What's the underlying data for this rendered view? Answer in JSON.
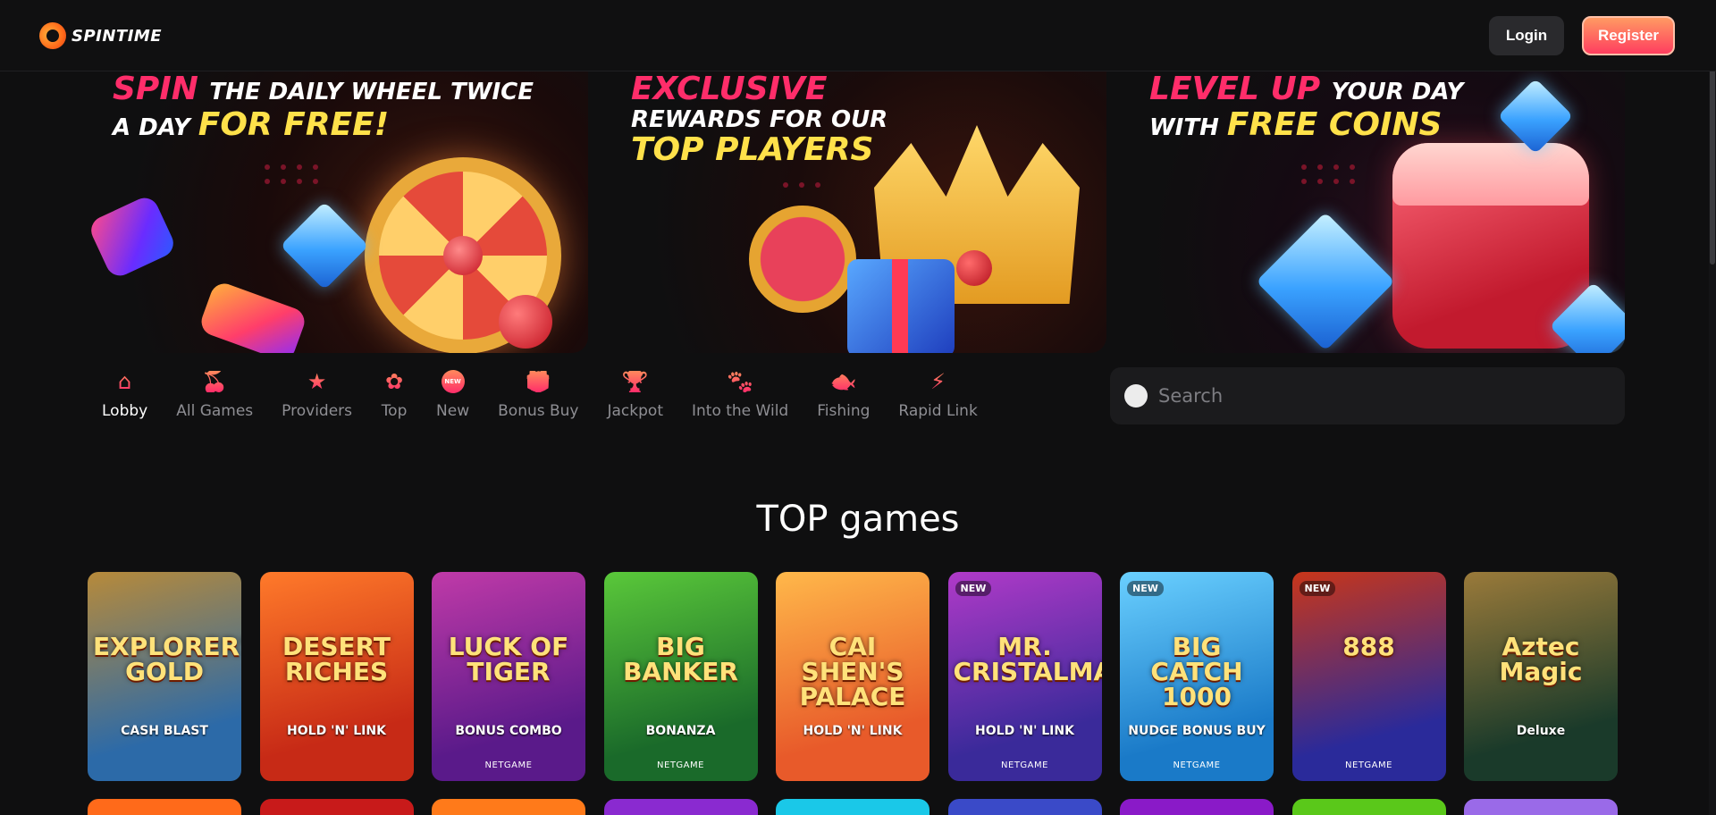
{
  "header": {
    "logo_text": "SPINTIME",
    "login_label": "Login",
    "register_label": "Register"
  },
  "banners": [
    {
      "lines": [
        [
          {
            "t": "SPIN ",
            "c": "pink",
            "s": "big"
          },
          {
            "t": "THE DAILY WHEEL TWICE",
            "c": "white",
            "s": "mid"
          }
        ],
        [
          {
            "t": "A DAY ",
            "c": "white",
            "s": "mid"
          },
          {
            "t": "FOR FREE!",
            "c": "yellow",
            "s": "big"
          }
        ]
      ]
    },
    {
      "lines": [
        [
          {
            "t": "EXCLUSIVE",
            "c": "pink",
            "s": "big"
          }
        ],
        [
          {
            "t": "REWARDS FOR OUR",
            "c": "white",
            "s": "mid"
          }
        ],
        [
          {
            "t": "TOP PLAYERS",
            "c": "yellow",
            "s": "big"
          }
        ]
      ]
    },
    {
      "lines": [
        [
          {
            "t": "LEVEL UP ",
            "c": "pink",
            "s": "big"
          },
          {
            "t": "YOUR DAY",
            "c": "white",
            "s": "mid"
          }
        ],
        [
          {
            "t": "WITH ",
            "c": "white",
            "s": "mid"
          },
          {
            "t": "FREE COINS",
            "c": "yellow",
            "s": "big"
          }
        ]
      ]
    }
  ],
  "categories": [
    {
      "label": "Lobby",
      "icon": "home-icon",
      "glyph": "⌂",
      "active": true
    },
    {
      "label": "All Games",
      "icon": "cherries-icon",
      "glyph": "🍒",
      "active": false
    },
    {
      "label": "Providers",
      "icon": "star-icon",
      "glyph": "★",
      "active": false
    },
    {
      "label": "Top",
      "icon": "badge-icon",
      "glyph": "✿",
      "active": false
    },
    {
      "label": "New",
      "icon": "new-badge-icon",
      "glyph": "NEW",
      "active": false
    },
    {
      "label": "Bonus Buy",
      "icon": "gift-icon",
      "glyph": "🎁",
      "active": false
    },
    {
      "label": "Jackpot",
      "icon": "trophy-icon",
      "glyph": "🏆",
      "active": false
    },
    {
      "label": "Into the Wild",
      "icon": "paw-icon",
      "glyph": "🐾",
      "active": false
    },
    {
      "label": "Fishing",
      "icon": "fish-icon",
      "glyph": "🐟",
      "active": false
    },
    {
      "label": "Rapid Link",
      "icon": "lightning-icon",
      "glyph": "⚡",
      "active": false
    }
  ],
  "search": {
    "placeholder": "Search"
  },
  "section_title": "TOP games",
  "games": [
    {
      "title": "EXPLORER'S GOLD",
      "subtitle": "CASH BLAST",
      "provider": "",
      "is_new": false,
      "colors": [
        "#2c6aa8",
        "#b78a3a"
      ]
    },
    {
      "title": "DESERT RICHES",
      "subtitle": "HOLD 'N' LINK",
      "provider": "",
      "is_new": false,
      "colors": [
        "#c72a16",
        "#ff7a2a"
      ]
    },
    {
      "title": "LUCK OF TIGER",
      "subtitle": "BONUS COMBO",
      "provider": "NETGAME",
      "is_new": false,
      "colors": [
        "#5a1a8a",
        "#c03aa8"
      ]
    },
    {
      "title": "BIG BANKER",
      "subtitle": "BONANZA",
      "provider": "NETGAME",
      "is_new": false,
      "colors": [
        "#1a6a2a",
        "#5ac83a"
      ]
    },
    {
      "title": "CAI SHEN'S PALACE",
      "subtitle": "HOLD 'N' LINK",
      "provider": "",
      "is_new": false,
      "colors": [
        "#e85a2a",
        "#ffb84a"
      ]
    },
    {
      "title": "MR. CRISTALMAN",
      "subtitle": "HOLD 'N' LINK",
      "provider": "NETGAME",
      "is_new": true,
      "colors": [
        "#3a2a9a",
        "#b03ac8"
      ]
    },
    {
      "title": "BIG CATCH 1000",
      "subtitle": "NUDGE BONUS BUY",
      "provider": "NETGAME",
      "is_new": true,
      "colors": [
        "#1a7ac8",
        "#6ad0ff"
      ]
    },
    {
      "title": "888",
      "subtitle": "",
      "provider": "NETGAME",
      "is_new": true,
      "colors": [
        "#2a2a9a",
        "#c8361a"
      ]
    },
    {
      "title": "Aztec Magic",
      "subtitle": "Deluxe",
      "provider": "",
      "is_new": false,
      "colors": [
        "#1a3a2a",
        "#9a7a3a"
      ]
    }
  ],
  "new_badge_label": "NEW",
  "row2_colors": [
    "#ff6a1a",
    "#c81a1a",
    "#ff7a1a",
    "#8a2ad0",
    "#1ac8e8",
    "#3a4ac8",
    "#8a1ac8",
    "#5ac81a",
    "#9a6ae8"
  ]
}
